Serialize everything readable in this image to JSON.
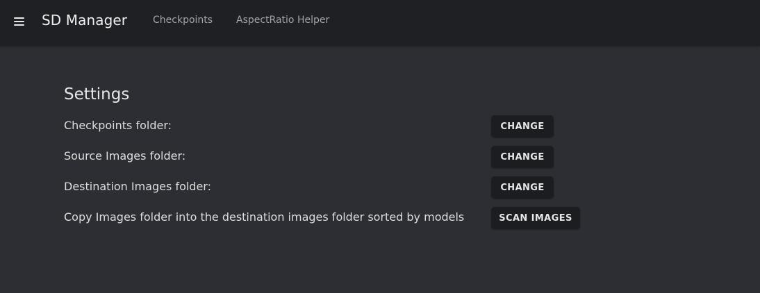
{
  "appbar": {
    "title": "SD Manager",
    "menu_icon": "hamburger-menu-icon",
    "nav": [
      {
        "label": "Checkpoints"
      },
      {
        "label": "AspectRatio Helper"
      }
    ]
  },
  "settings": {
    "title": "Settings",
    "rows": [
      {
        "label": "Checkpoints folder:",
        "button": "CHANGE"
      },
      {
        "label": "Source Images folder:",
        "button": "CHANGE"
      },
      {
        "label": "Destination Images folder:",
        "button": "CHANGE"
      },
      {
        "label": "Copy Images folder into the destination images folder sorted by models",
        "button": "SCAN IMAGES"
      }
    ]
  },
  "colors": {
    "appbar_bg": "#1f2024",
    "page_bg": "#2d2e33",
    "button_bg": "#1c1d21",
    "text": "#e3e3e3",
    "nav_text": "#a3a4a8"
  }
}
